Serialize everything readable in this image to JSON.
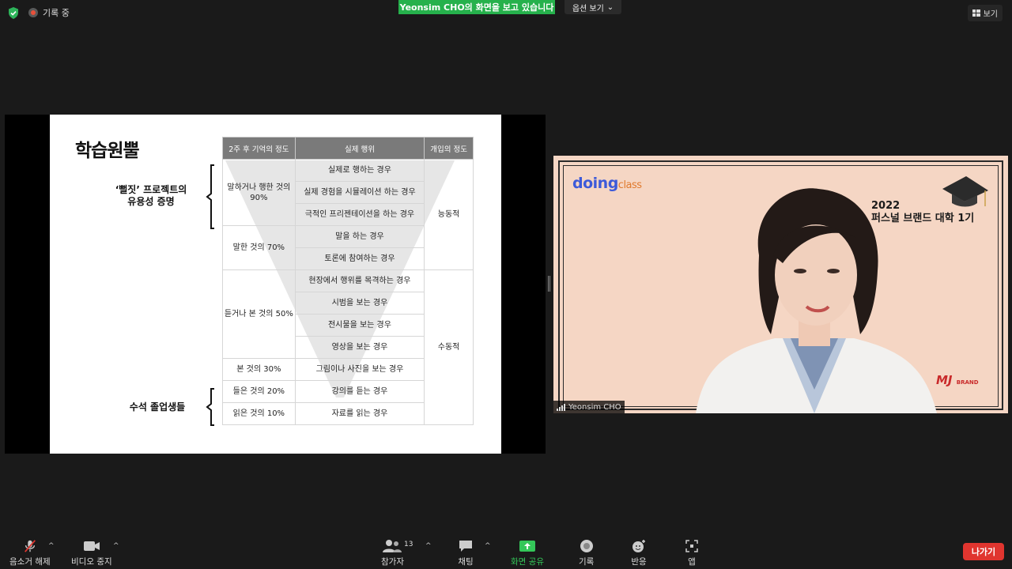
{
  "top": {
    "recording_label": "기록 중",
    "sharing_banner": "Yeonsim  CHO의 화면을 보고 있습니다",
    "view_options_label": "옵션 보기",
    "view_button_label": "보기"
  },
  "slide": {
    "title": "학습원뿔",
    "label_a": "‘뻘짓’ 프로젝트의 유용성 증명",
    "label_b": "수석 졸업생들",
    "table": {
      "headers": [
        "2주 후 기억의 정도",
        "실제 행위",
        "개입의 정도"
      ],
      "retention": [
        "말하거나 행한 것의 90%",
        "말한 것의 70%",
        "듣거나 본 것의 50%",
        "본 것의 30%",
        "들은 것의 20%",
        "읽은 것의 10%"
      ],
      "actions": [
        "실제로 행하는 경우",
        "실제 경험을 시뮬레이션 하는 경우",
        "극적인 프리젠테이션을 하는 경우",
        "말을 하는 경우",
        "토론에 참여하는 경우",
        "현장에서 행위를 목격하는 경우",
        "시범을 보는 경우",
        "전시물을 보는 경우",
        "영상을 보는 경우",
        "그림이나 사진을 보는 경우",
        "강의를 듣는 경우",
        "자료를 읽는 경우"
      ],
      "involvement": [
        "능동적",
        "수동적"
      ]
    }
  },
  "video": {
    "logo_main": "doing",
    "logo_sub": "class",
    "program_year": "2022",
    "program_name": "퍼스널 브랜드 대학 1기",
    "brand_mark": "MJ",
    "brand_small": "BRAND",
    "participant_name": "Yeonsim CHO"
  },
  "toolbar": {
    "mute_label": "음소거 해제",
    "video_label": "비디오 중지",
    "participants_label": "참가자",
    "participants_count": "13",
    "chat_label": "채팅",
    "share_label": "화면 공유",
    "record_label": "기록",
    "reactions_label": "반응",
    "apps_label": "앱",
    "leave_label": "나가기"
  },
  "colors": {
    "share_green": "#26b14c",
    "leave_red": "#e0352f",
    "video_bg": "#f5d6c4",
    "table_header": "#7a7a7a"
  }
}
